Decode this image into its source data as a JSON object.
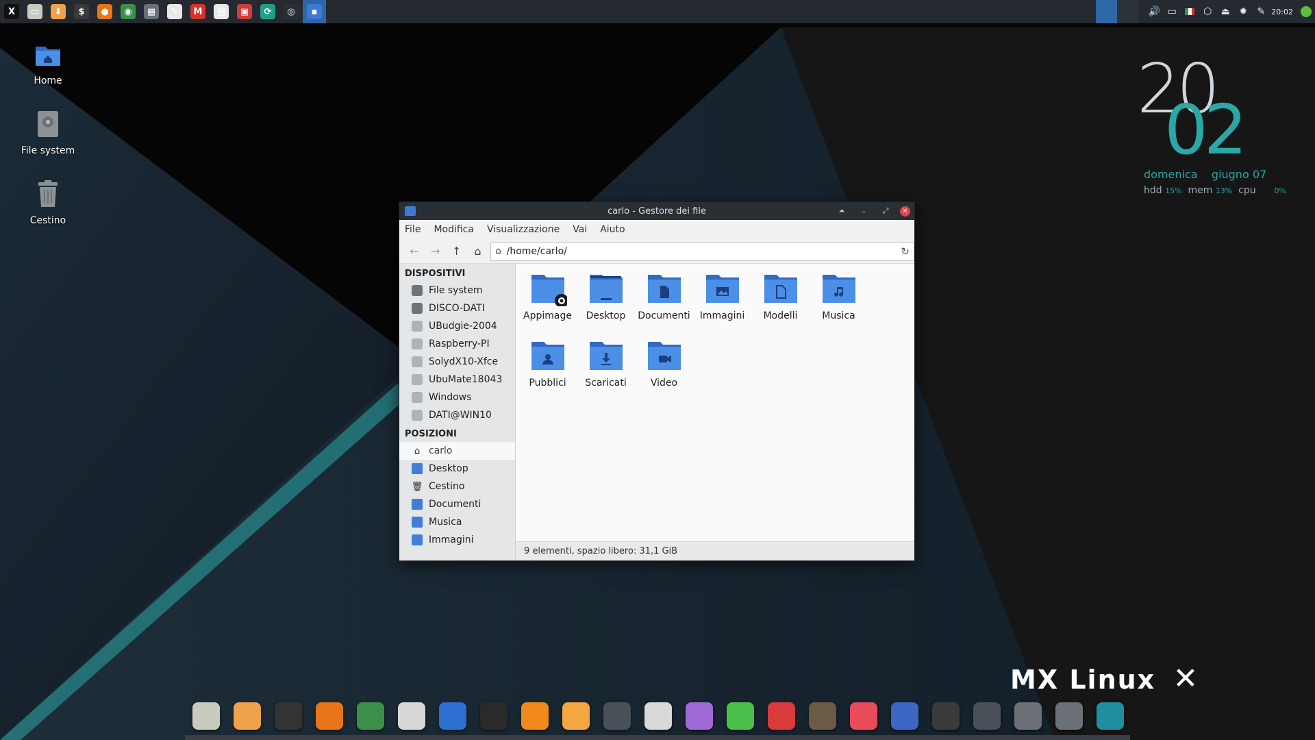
{
  "top_panel": {
    "launchers": [
      {
        "icon": "mx-menu-icon",
        "glyph": "X",
        "bg": "#111111"
      },
      {
        "icon": "file-manager-icon",
        "glyph": "▭",
        "bg": "#c9cbbf"
      },
      {
        "icon": "download-icon",
        "glyph": "⬇",
        "bg": "#f0a24a"
      },
      {
        "icon": "terminal-icon",
        "glyph": "$",
        "bg": "#3a3a3a"
      },
      {
        "icon": "firefox-icon",
        "glyph": "●",
        "bg": "#e8751a"
      },
      {
        "icon": "chrome-icon",
        "glyph": "◉",
        "bg": "#3a8f4a"
      },
      {
        "icon": "calculator-icon",
        "glyph": "▦",
        "bg": "#6a7077"
      },
      {
        "icon": "text-editor-icon",
        "glyph": "✎",
        "bg": "#e8e8e8"
      },
      {
        "icon": "pdf-icon",
        "glyph": "M",
        "bg": "#d8322e"
      },
      {
        "icon": "calendar-icon",
        "glyph": "▤",
        "bg": "#eaeaea"
      },
      {
        "icon": "screen-recorder-icon",
        "glyph": "▣",
        "bg": "#d43a3a"
      },
      {
        "icon": "sync-icon",
        "glyph": "⟳",
        "bg": "#1f9e8a"
      },
      {
        "icon": "webcam-icon",
        "glyph": "◎",
        "bg": "#2b2f35"
      },
      {
        "icon": "window-task-icon",
        "glyph": "▪",
        "bg": "#3d7ad6"
      }
    ],
    "tray": {
      "icons": [
        "volume-icon",
        "display-icon",
        "italian-flag-icon",
        "network-icon",
        "eject-icon",
        "updates-icon",
        "clip-icon"
      ],
      "clock": "20:02"
    }
  },
  "desktop_icons": [
    {
      "label": "Home",
      "icon": "home-folder-icon"
    },
    {
      "label": "File system",
      "icon": "drive-icon"
    },
    {
      "label": "Cestino",
      "icon": "trash-icon"
    }
  ],
  "conky": {
    "hour": "20",
    "minute": "02",
    "date": "domenica    giugno 07",
    "hdd_label": "hdd",
    "hdd_value": "15%",
    "mem_label": "mem",
    "mem_value": "13%",
    "cpu_label": "cpu",
    "cpu_value": "0%"
  },
  "window": {
    "title": "carlo - Gestore dei file",
    "menu": [
      "File",
      "Modifica",
      "Visualizzazione",
      "Vai",
      "Aiuto"
    ],
    "path": "/home/carlo/",
    "sidebar": {
      "devices_header": "DISPOSITIVI",
      "devices": [
        {
          "label": "File system",
          "kind": "disk"
        },
        {
          "label": "DISCO-DATI",
          "kind": "disk"
        },
        {
          "label": "UBudgie-2004",
          "kind": "disk-light"
        },
        {
          "label": "Raspberry-PI",
          "kind": "disk-light"
        },
        {
          "label": "SolydX10-Xfce",
          "kind": "disk-light"
        },
        {
          "label": "UbuMate18043",
          "kind": "disk-light"
        },
        {
          "label": "Windows",
          "kind": "disk-light"
        },
        {
          "label": "DATI@WIN10",
          "kind": "disk-light"
        }
      ],
      "places_header": "POSIZIONI",
      "places": [
        {
          "label": "carlo",
          "kind": "home"
        },
        {
          "label": "Desktop",
          "kind": "folder"
        },
        {
          "label": "Cestino",
          "kind": "trash"
        },
        {
          "label": "Documenti",
          "kind": "folder"
        },
        {
          "label": "Musica",
          "kind": "folder"
        },
        {
          "label": "Immagini",
          "kind": "folder"
        }
      ]
    },
    "files": [
      {
        "name": "Appimage",
        "emblem": "gear"
      },
      {
        "name": "Desktop",
        "emblem": "desktop"
      },
      {
        "name": "Documenti",
        "emblem": "doc"
      },
      {
        "name": "Immagini",
        "emblem": "image"
      },
      {
        "name": "Modelli",
        "emblem": "template"
      },
      {
        "name": "Musica",
        "emblem": "music"
      },
      {
        "name": "Pubblici",
        "emblem": "user"
      },
      {
        "name": "Scaricati",
        "emblem": "download"
      },
      {
        "name": "Video",
        "emblem": "video"
      }
    ],
    "status": "9 elementi, spazio libero: 31,1 GiB"
  },
  "dock": [
    {
      "icon": "file-manager-dock-icon",
      "color": "#c9cbbf"
    },
    {
      "icon": "downloader-dock-icon",
      "color": "#f0a24a"
    },
    {
      "icon": "terminal-dock-icon",
      "color": "#333333"
    },
    {
      "icon": "firefox-dock-icon",
      "color": "#e8751a"
    },
    {
      "icon": "chrome-dock-icon",
      "color": "#3a8f4a"
    },
    {
      "icon": "usb-tool-dock-icon",
      "color": "#d8d8d8"
    },
    {
      "icon": "audacity-dock-icon",
      "color": "#2d6fd1"
    },
    {
      "icon": "video-editor-dock-icon",
      "color": "#2a2a2a"
    },
    {
      "icon": "vlc-dock-icon",
      "color": "#f08a1c"
    },
    {
      "icon": "orange-dock-icon",
      "color": "#f4a640"
    },
    {
      "icon": "screencast-dock-icon",
      "color": "#4a5058"
    },
    {
      "icon": "disc-burner-dock-icon",
      "color": "#d9d9d9"
    },
    {
      "icon": "music-tagger-dock-icon",
      "color": "#a06ad6"
    },
    {
      "icon": "audio-converter-dock-icon",
      "color": "#4ac04a"
    },
    {
      "icon": "cocktail-dock-icon",
      "color": "#d93a3a"
    },
    {
      "icon": "gimp-dock-icon",
      "color": "#6b5a44"
    },
    {
      "icon": "image-viewer-dock-icon",
      "color": "#e94b5b"
    },
    {
      "icon": "document-dock-icon",
      "color": "#3c67c4"
    },
    {
      "icon": "package-installer-dock-icon",
      "color": "#3a3a3a"
    },
    {
      "icon": "eject-dock-icon",
      "color": "#4a5058"
    },
    {
      "icon": "disk-settings-dock-icon",
      "color": "#6c7177"
    },
    {
      "icon": "disk-repair-dock-icon",
      "color": "#6c7177"
    },
    {
      "icon": "mx-tools-dock-icon",
      "color": "#1f8fa0"
    }
  ],
  "branding": {
    "logo_text": "MX Linux"
  },
  "colors": {
    "accent": "#3d7ad6",
    "teal": "#2aa7a7",
    "close": "#e1414b"
  }
}
